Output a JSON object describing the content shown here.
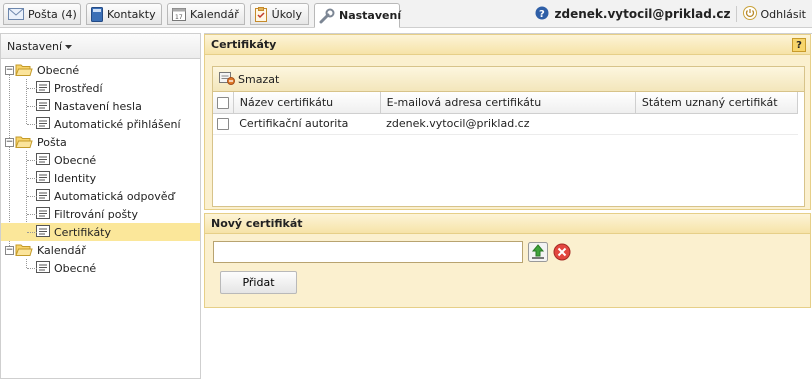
{
  "tabs": [
    {
      "label": "Pošta (4)",
      "icon": "mail-icon"
    },
    {
      "label": "Kontakty",
      "icon": "contacts-icon"
    },
    {
      "label": "Kalendář",
      "icon": "calendar-icon"
    },
    {
      "label": "Úkoly",
      "icon": "tasks-icon"
    },
    {
      "label": "Nastavení",
      "icon": "wrench-icon"
    }
  ],
  "user": {
    "email": "zdenek.vytocil@priklad.cz",
    "logout_label": "Odhlásit"
  },
  "sidebar": {
    "header": "Nastavení",
    "tree": [
      {
        "label": "Obecné",
        "type": "folder"
      },
      {
        "label": "Prostředí",
        "type": "page"
      },
      {
        "label": "Nastavení hesla",
        "type": "page"
      },
      {
        "label": "Automatické přihlášení",
        "type": "page"
      },
      {
        "label": "Pošta",
        "type": "folder"
      },
      {
        "label": "Obecné",
        "type": "page"
      },
      {
        "label": "Identity",
        "type": "page"
      },
      {
        "label": "Automatická odpověď",
        "type": "page"
      },
      {
        "label": "Filtrování pošty",
        "type": "page"
      },
      {
        "label": "Certifikáty",
        "type": "page",
        "selected": true
      },
      {
        "label": "Kalendář",
        "type": "folder"
      },
      {
        "label": "Obecné",
        "type": "page"
      }
    ]
  },
  "certificates": {
    "title": "Certifikáty",
    "help_label": "?",
    "delete_label": "Smazat",
    "columns": [
      "Název certifikátu",
      "E-mailová adresa certifikátu",
      "Státem uznaný certifikát"
    ],
    "rows": [
      {
        "name": "Certifikační autorita",
        "email": "zdenek.vytocil@priklad.cz",
        "state": ""
      }
    ]
  },
  "new_certificate": {
    "title": "Nový certifikát",
    "input_value": "",
    "add_label": "Přidat"
  },
  "colors": {
    "section_bg": "#fbf0cf",
    "selected_bg": "#fbe79a",
    "folder": "#f2c94c"
  }
}
